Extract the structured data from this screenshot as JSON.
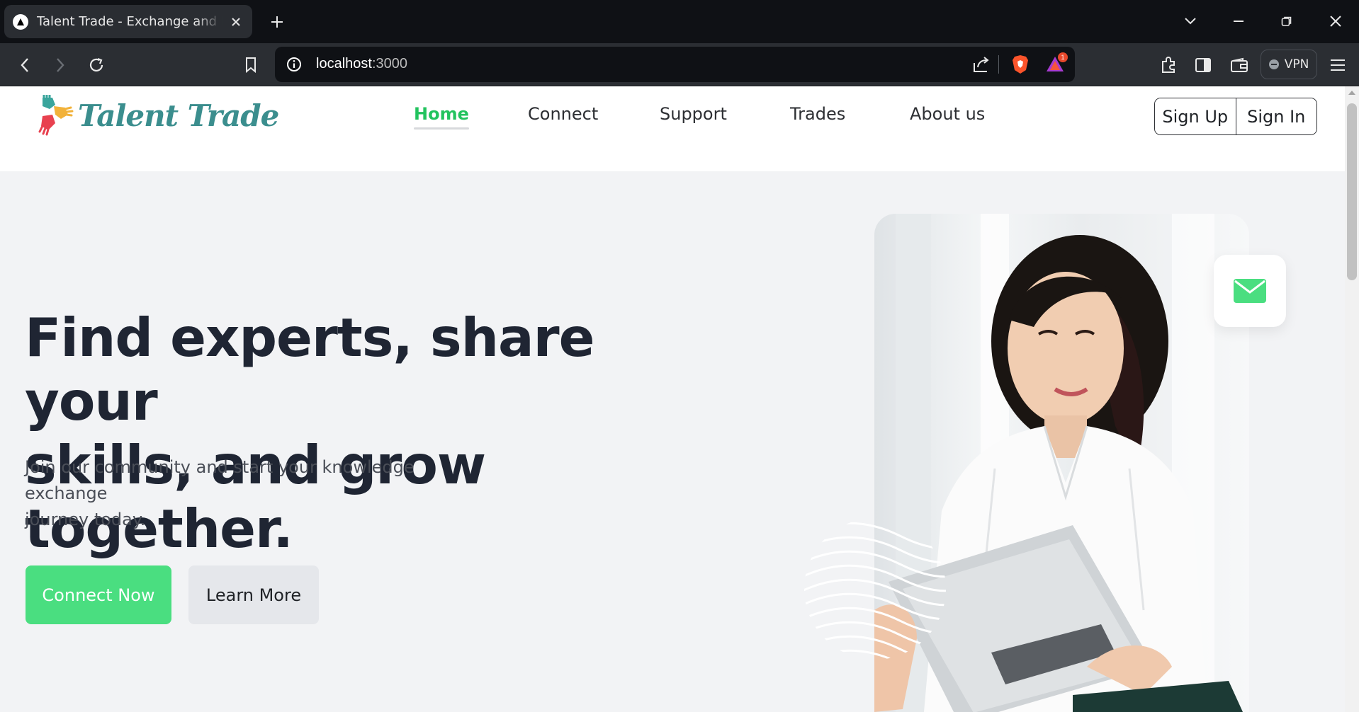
{
  "browser": {
    "tab_title": "Talent Trade - Exchange and Expertise",
    "url_host": "localhost",
    "url_port": ":3000",
    "vpn_label": "VPN",
    "notification_count": "1"
  },
  "nav": {
    "brand": "Talent Trade",
    "links": [
      {
        "label": "Home",
        "active": true
      },
      {
        "label": "Connect",
        "active": false
      },
      {
        "label": "Support",
        "active": false
      },
      {
        "label": "Trades",
        "active": false
      },
      {
        "label": "About us",
        "active": false
      }
    ],
    "sign_up": "Sign Up",
    "sign_in": "Sign In"
  },
  "hero": {
    "title_line1": "Find experts, share your",
    "title_line2": "skills, and grow together.",
    "subtitle_line1": "Join our community and start your knowledge exchange",
    "subtitle_line2": "journey today.",
    "primary_cta": "Connect Now",
    "secondary_cta": "Learn More"
  },
  "colors": {
    "accent": "#22c35e",
    "primary_button": "#4ade80",
    "secondary_button": "#e5e7eb",
    "heading": "#1f2533",
    "brand_teal": "#3b8e8e"
  },
  "icons": [
    "tab-favicon-icon",
    "close-tab-icon",
    "new-tab-icon",
    "tab-search-icon",
    "minimize-icon",
    "restore-icon",
    "close-window-icon",
    "back-icon",
    "forward-icon",
    "reload-icon",
    "bookmark-icon",
    "site-info-icon",
    "share-icon",
    "brave-shields-icon",
    "brave-rewards-icon",
    "extensions-icon",
    "sidebar-icon",
    "wallet-icon",
    "vpn-icon",
    "menu-icon",
    "mail-icon"
  ]
}
